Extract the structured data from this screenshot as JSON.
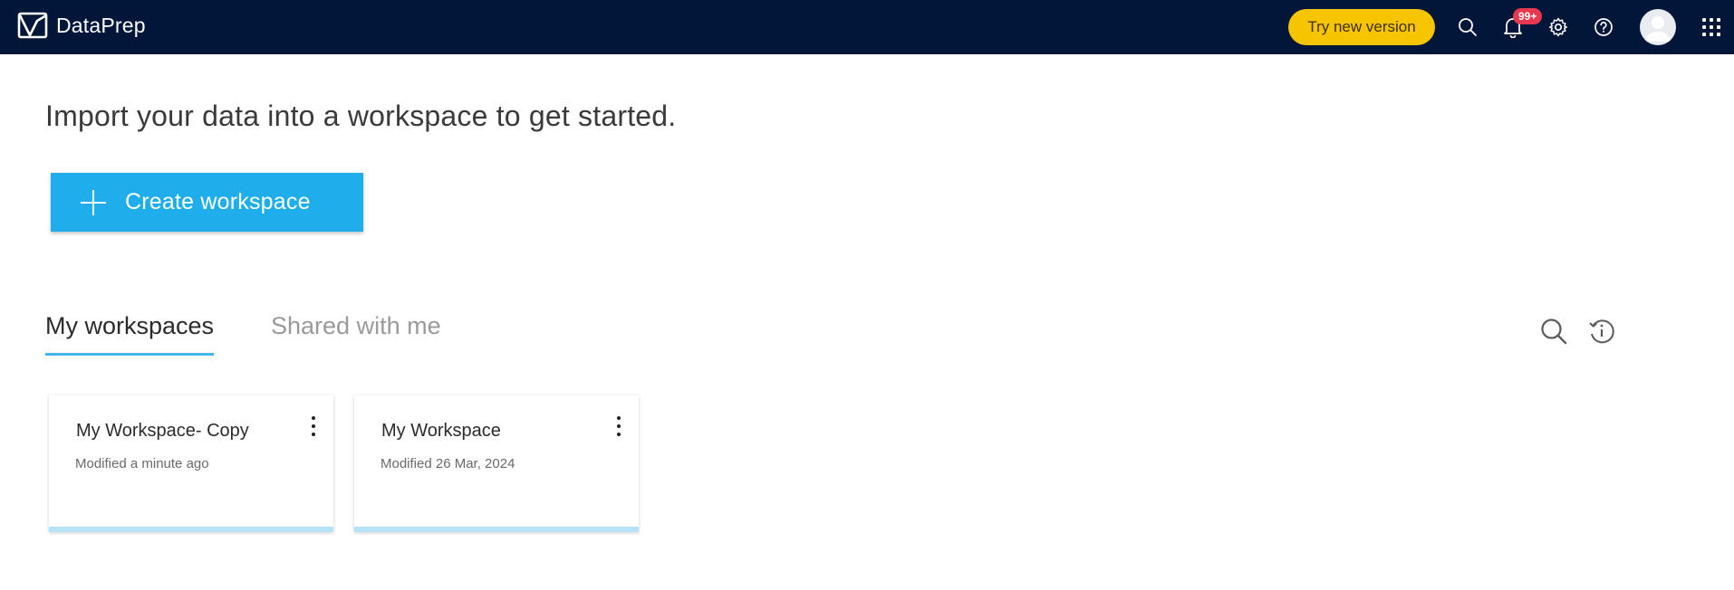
{
  "header": {
    "app_name": "DataPrep",
    "try_new_version_label": "Try new version",
    "notification_count": "99+",
    "icons": [
      "search-icon",
      "bell-icon",
      "gear-icon",
      "help-icon",
      "avatar",
      "apps-grid-icon"
    ],
    "colors": {
      "topbar": "#02163a",
      "try_button": "#f7c500",
      "badge": "#e8384f"
    }
  },
  "main": {
    "headline": "Import your data into a workspace to get started.",
    "create_button_label": "Create workspace",
    "tabs": [
      {
        "label": "My workspaces",
        "active": true
      },
      {
        "label": "Shared with me",
        "active": false
      }
    ],
    "tools": [
      "search-icon",
      "history-info-icon"
    ],
    "workspaces": [
      {
        "title": "My Workspace- Copy",
        "modified": "Modified a minute ago"
      },
      {
        "title": "My Workspace",
        "modified": "Modified 26 Mar, 2024"
      }
    ],
    "colors": {
      "accent": "#1fadeb",
      "tab_underline": "#46b4ee",
      "card_bar": "#b5e3f8"
    }
  }
}
